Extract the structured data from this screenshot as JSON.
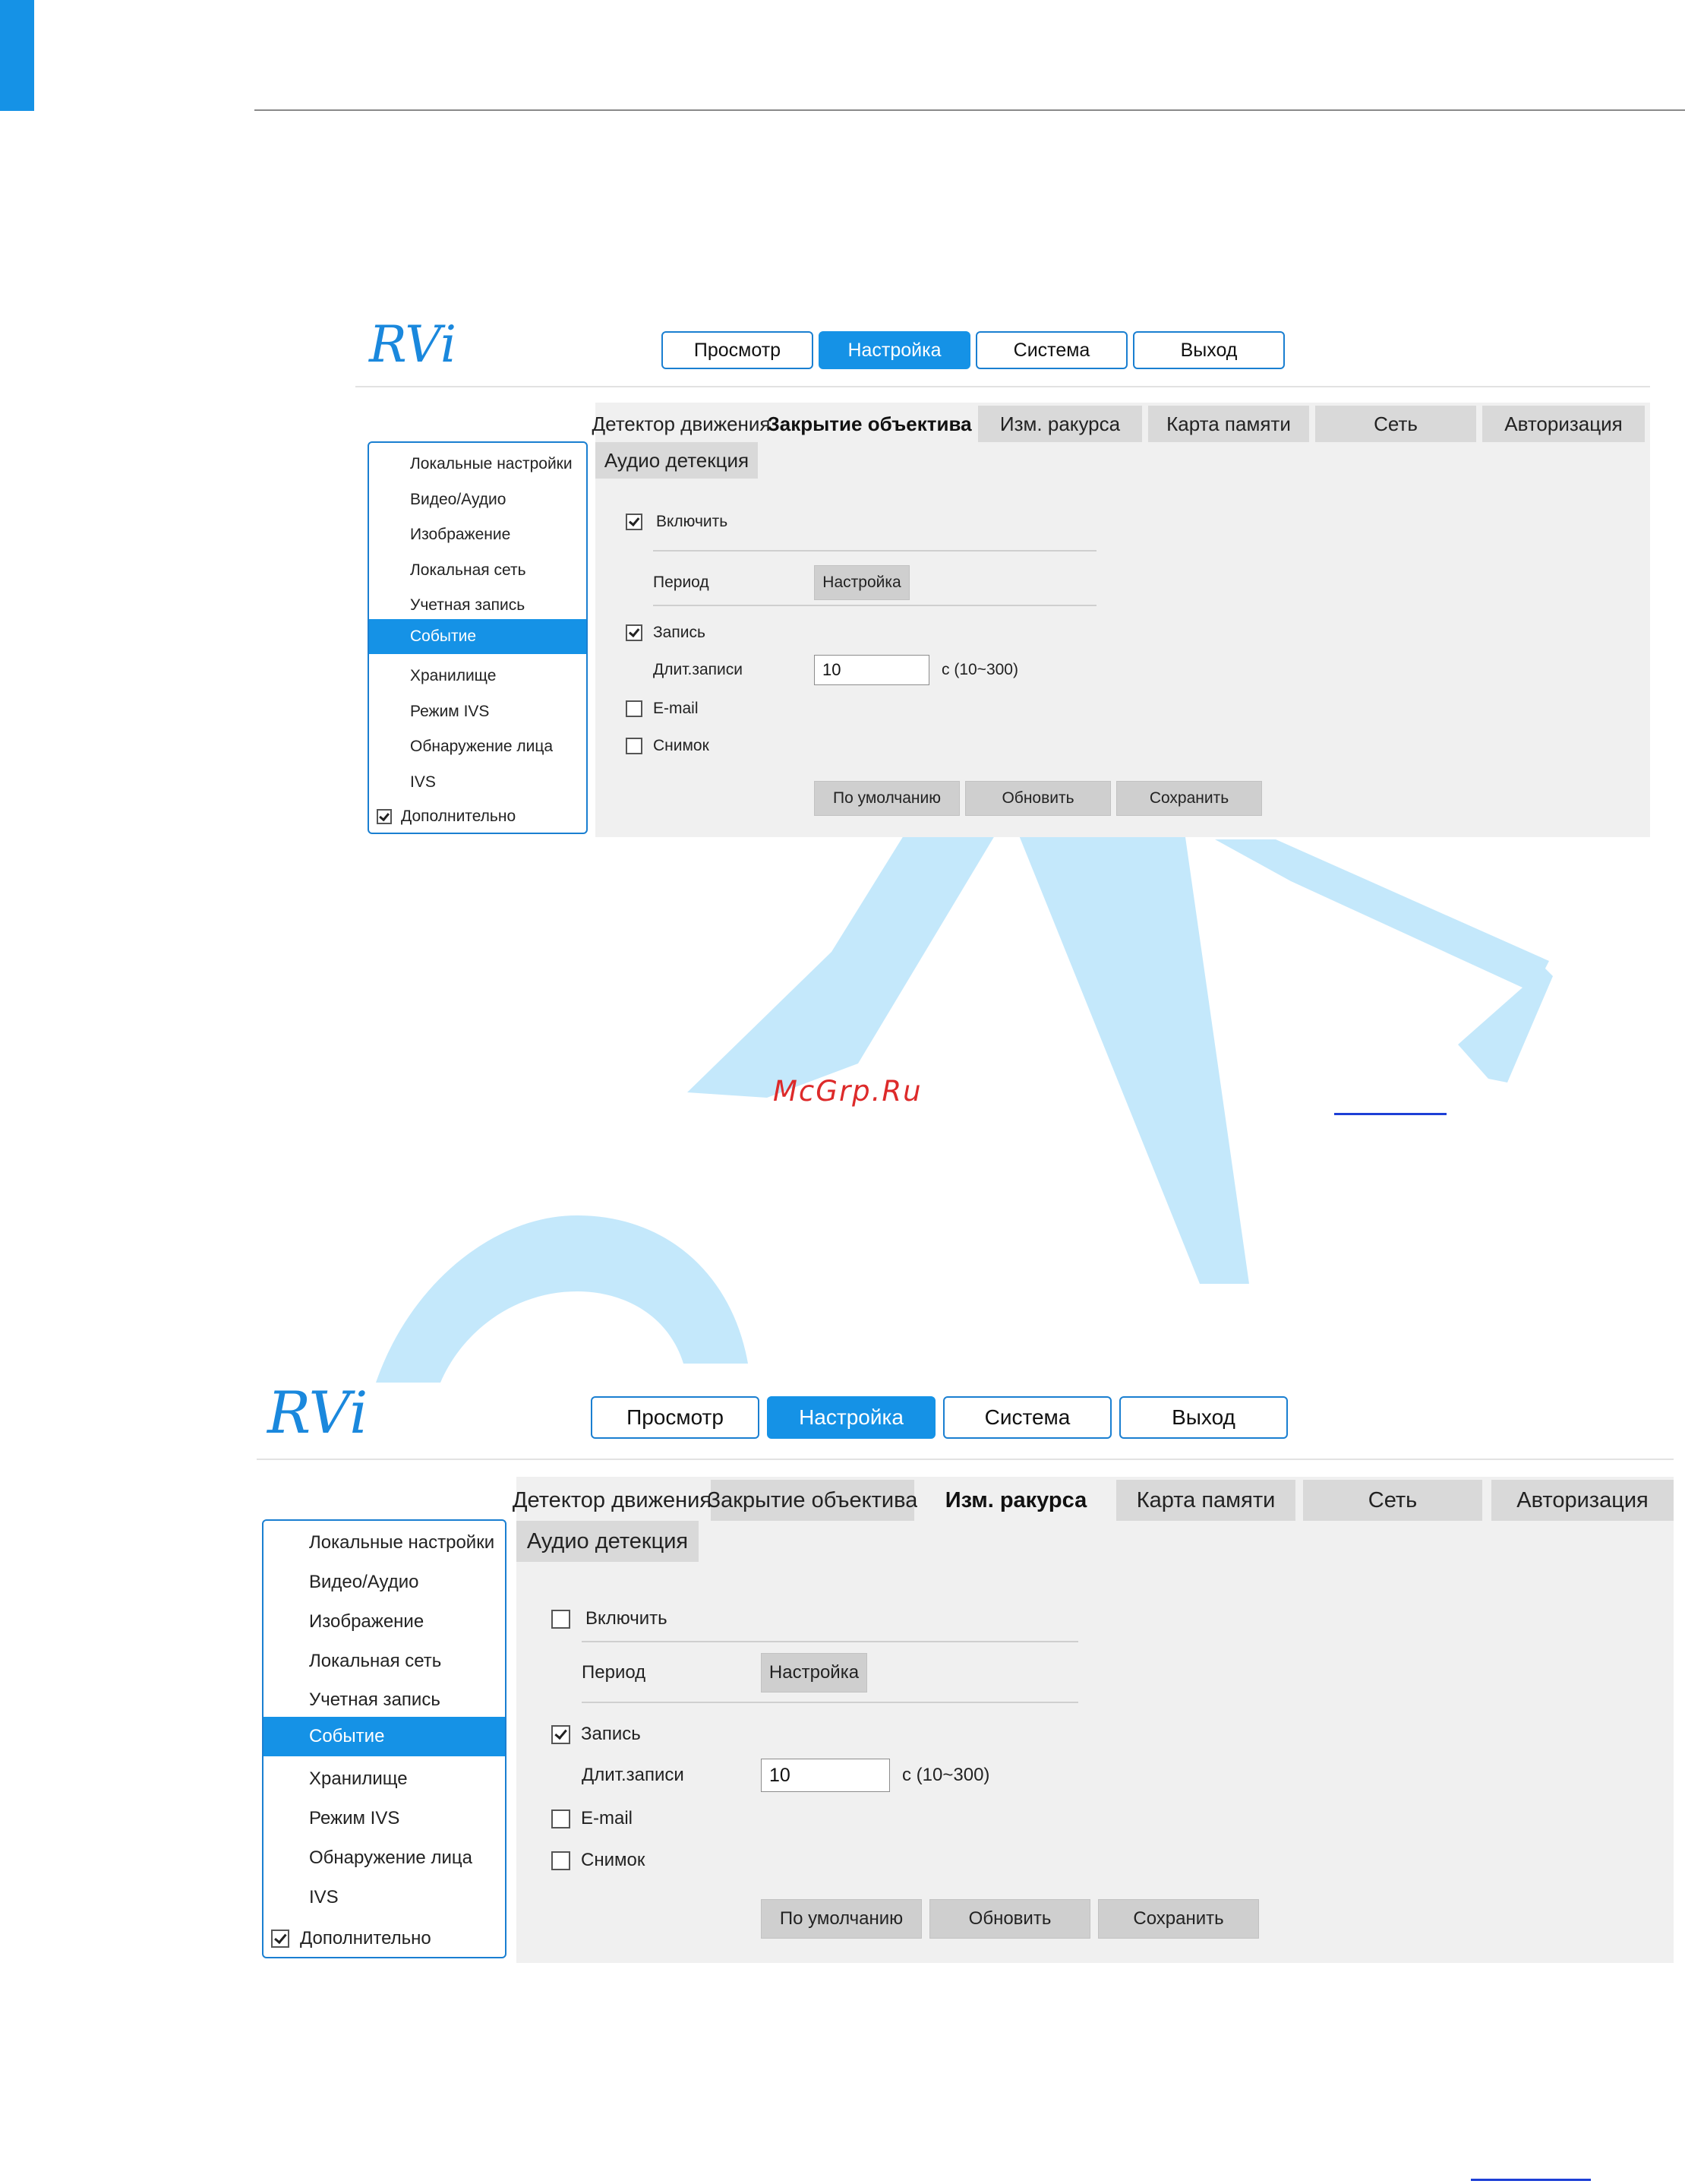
{
  "app": {
    "logo_text": "RVi",
    "nav": [
      "Просмотр",
      "Настройка",
      "Система",
      "Выход"
    ],
    "nav_active": 1
  },
  "sidebar": {
    "items": [
      "Локальные настройки",
      "Видео/Аудио",
      "Изображение",
      "Локальная сеть",
      "Учетная запись",
      "Событие",
      "Хранилище",
      "Режим IVS",
      "Обнаружение лица",
      "IVS"
    ],
    "active_index": 5,
    "extra_checkbox": {
      "label": "Дополнительно",
      "checked": true
    }
  },
  "tabs": [
    "Детектор движения",
    "Закрытие объектива",
    "Изм. ракурса",
    "Карта памяти",
    "Сеть",
    "Авторизация",
    "Аудио детекция"
  ],
  "form": {
    "enable_label": "Включить",
    "period_label": "Период",
    "period_button": "Настройка",
    "record_label": "Запись",
    "duration_label": "Длит.записи",
    "duration_value": "10",
    "duration_range": "с (10~300)",
    "email_label": "E-mail",
    "snapshot_label": "Снимок",
    "default_button": "По умолчанию",
    "refresh_button": "Обновить",
    "save_button": "Сохранить"
  },
  "screens": [
    {
      "active_tab": 1,
      "enable_checked": true,
      "record_checked": true,
      "email_checked": false,
      "snapshot_checked": false
    },
    {
      "active_tab": 2,
      "enable_checked": false,
      "record_checked": true,
      "email_checked": false,
      "snapshot_checked": false
    }
  ],
  "watermark": {
    "text": "McGrp.Ru"
  },
  "colors": {
    "accent": "#1592e6",
    "panel_bg": "#f0f0f0",
    "tab_bg": "#d9d9d9",
    "button_bg": "#cfcfcf",
    "watermark": "#c4e8fb",
    "watermark_text": "#dd2a2a"
  }
}
